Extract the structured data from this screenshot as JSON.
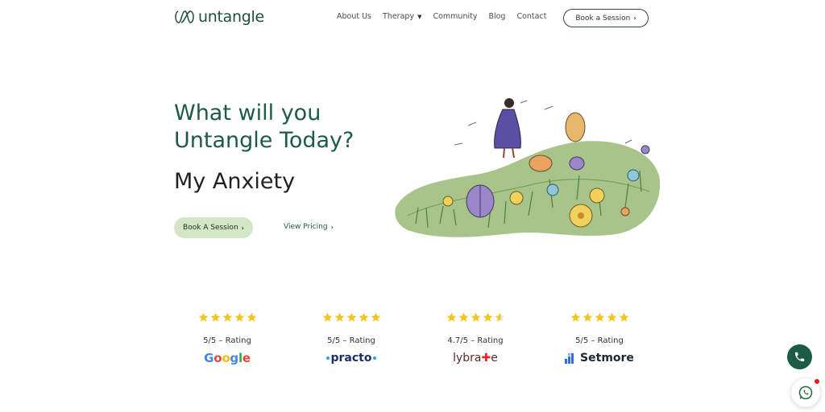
{
  "brand": {
    "name": "untangle"
  },
  "nav": {
    "items": [
      {
        "label": "About Us",
        "has_dropdown": false
      },
      {
        "label": "Therapy",
        "has_dropdown": true
      },
      {
        "label": "Community",
        "has_dropdown": false
      },
      {
        "label": "Blog",
        "has_dropdown": false
      },
      {
        "label": "Contact",
        "has_dropdown": false
      }
    ],
    "cta_label": "Book a Session"
  },
  "hero": {
    "title_line1": "What will you",
    "title_line2": "Untangle Today?",
    "subtitle": "My Anxiety",
    "primary_cta": "Book A Session",
    "secondary_cta": "View Pricing"
  },
  "ratings": [
    {
      "stars": 5,
      "text": "5/5 – Rating",
      "platform": "Google"
    },
    {
      "stars": 5,
      "text": "5/5 – Rating",
      "platform": "practo"
    },
    {
      "stars": 4.7,
      "text": "4.7/5 – Rating",
      "platform": "lybrate"
    },
    {
      "stars": 5,
      "text": "5/5 – Rating",
      "platform": "Setmore"
    }
  ],
  "colors": {
    "brand_green": "#1d5c44",
    "button_light_green": "#d4e7c5",
    "star_yellow": "#f5c518"
  },
  "icons": {
    "phone": "phone-icon",
    "whatsapp": "whatsapp-icon",
    "chevron": "chevron-right-icon"
  }
}
